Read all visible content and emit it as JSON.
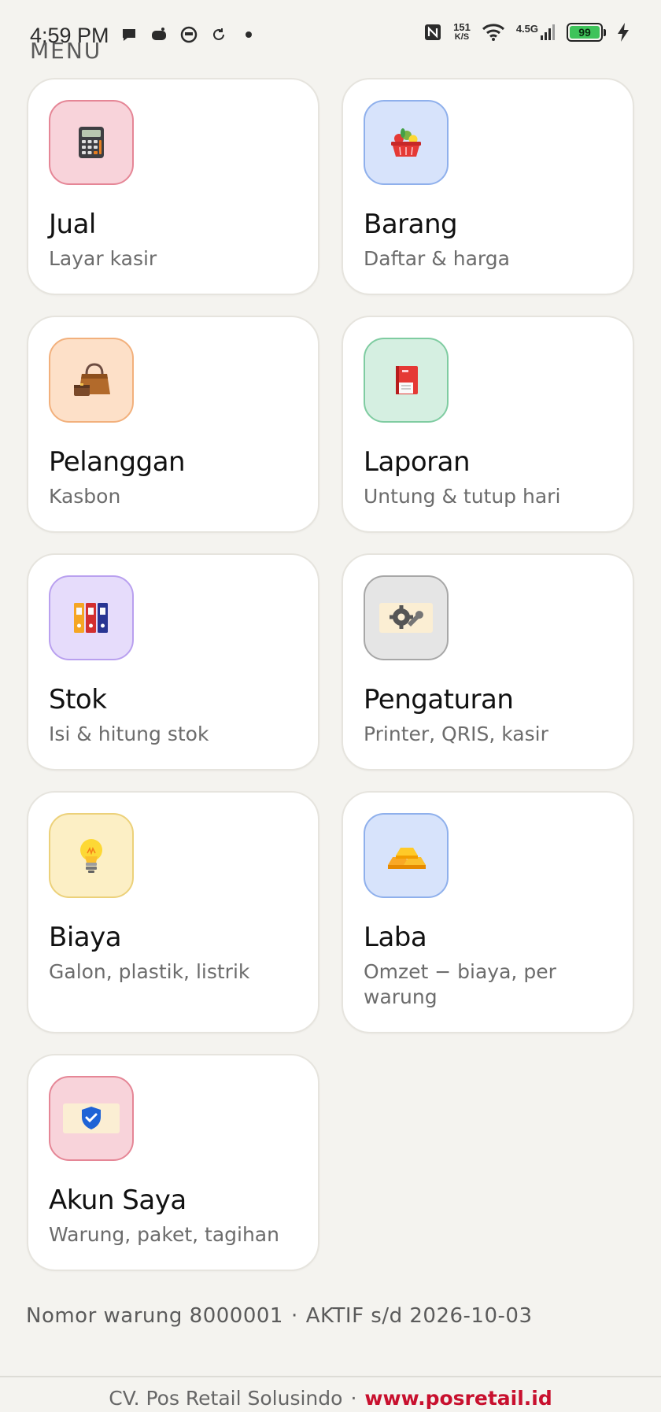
{
  "status_bar": {
    "time": "4:59 PM",
    "net_speed_value": "151",
    "net_speed_unit": "K/S",
    "network": "4.5G",
    "battery": "99"
  },
  "header": {
    "title": "MENU"
  },
  "menu": [
    {
      "title": "Jual",
      "subtitle": "Layar kasir",
      "icon": "calculator-icon",
      "bg": "#f8d3da",
      "border": "#e58696"
    },
    {
      "title": "Barang",
      "subtitle": "Daftar & harga",
      "icon": "shopping-basket-icon",
      "bg": "#d7e3fb",
      "border": "#8fb0ec"
    },
    {
      "title": "Pelanggan",
      "subtitle": "Kasbon",
      "icon": "handbag-icon",
      "bg": "#fde0c8",
      "border": "#f2b07c"
    },
    {
      "title": "Laporan",
      "subtitle": "Untung & tutup hari",
      "icon": "notebook-icon",
      "bg": "#d5efe1",
      "border": "#7fcca1"
    },
    {
      "title": "Stok",
      "subtitle": "Isi & hitung stok",
      "icon": "binders-icon",
      "bg": "#e6dcfb",
      "border": "#b9a0ef"
    },
    {
      "title": "Pengaturan",
      "subtitle": "Printer, QRIS, kasir",
      "icon": "gear-wrench-icon",
      "bg": "#e5e5e5",
      "border": "#a7a7a7"
    },
    {
      "title": "Biaya",
      "subtitle": "Galon, plastik, listrik",
      "icon": "lightbulb-icon",
      "bg": "#fcefc5",
      "border": "#ecd17a"
    },
    {
      "title": "Laba",
      "subtitle": "Omzet − biaya, per warung",
      "icon": "gold-bars-icon",
      "bg": "#d7e3fb",
      "border": "#8fb0ec"
    },
    {
      "title": "Akun Saya",
      "subtitle": "Warung, paket, tagihan",
      "icon": "shield-check-icon",
      "bg": "#f8d3da",
      "border": "#e58696"
    }
  ],
  "footer": {
    "store_number": "Nomor warung 8000001",
    "separator": "·",
    "active_until": "AKTIF s/d 2026-10-03",
    "company": "CV. Pos Retail Solusindo",
    "website": "www.posretail.id"
  }
}
